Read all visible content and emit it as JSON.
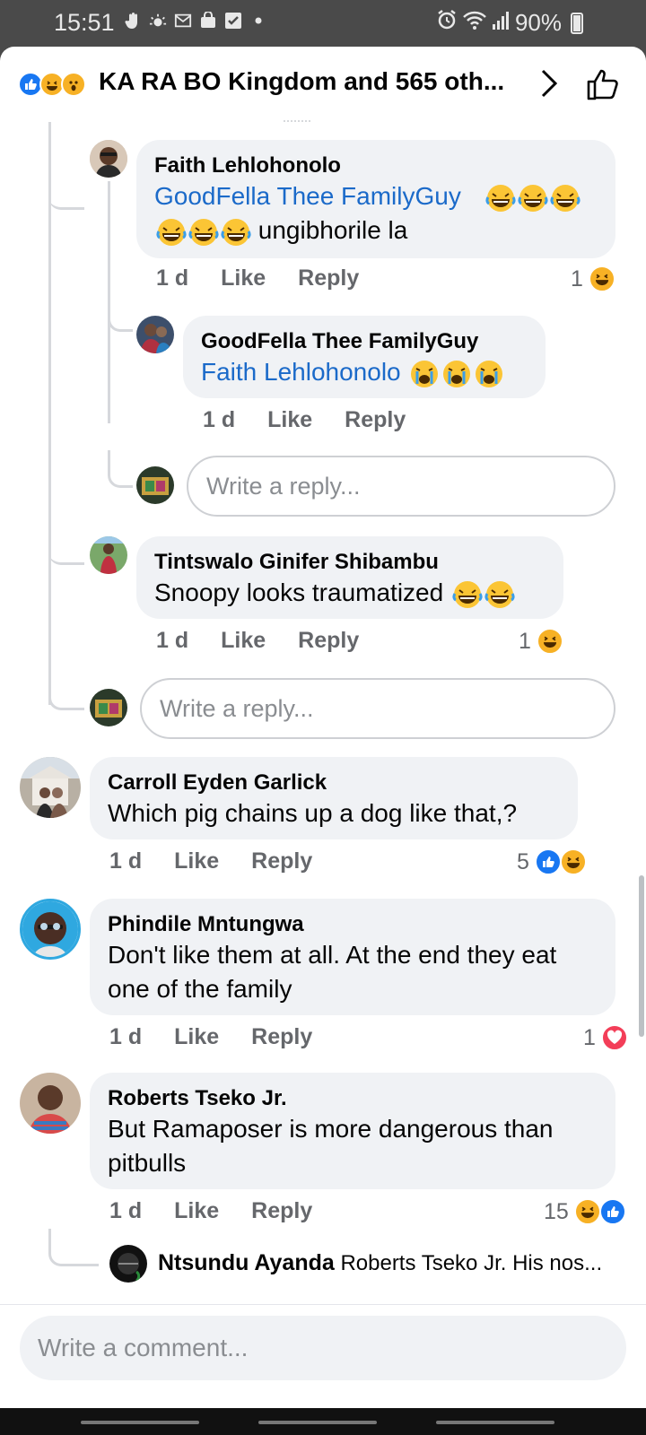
{
  "status_bar": {
    "time": "15:51",
    "battery": "90%",
    "left_icons": [
      "hand-icon",
      "weather-icon",
      "gmail-icon",
      "bag-icon",
      "check-icon",
      "dot-icon"
    ],
    "right_icons": [
      "alarm-icon",
      "wifi-icon",
      "signal-icon",
      "battery-icon"
    ]
  },
  "header": {
    "title": "KA RA BO Kingdom and 565 oth...",
    "reactions": [
      "like",
      "haha",
      "wow"
    ]
  },
  "comments": [
    {
      "name": "Faith Lehlohonolo",
      "mention": "GoodFella Thee FamilyGuy",
      "text": "ungibhorile la",
      "emojis": [
        "laugh-cry",
        "laugh-cry",
        "laugh-cry",
        "laugh-cry",
        "laugh-cry",
        "laugh-cry"
      ],
      "time": "1 d",
      "like": "Like",
      "reply": "Reply",
      "reaction_count": "1",
      "reactions": [
        "haha"
      ]
    },
    {
      "name": "GoodFella Thee FamilyGuy",
      "mention": "Faith Lehlohonolo",
      "text": "",
      "emojis": [
        "crying",
        "crying",
        "crying"
      ],
      "time": "1 d",
      "like": "Like",
      "reply": "Reply"
    },
    {
      "name": "Tintswalo Ginifer Shibambu",
      "text": "Snoopy looks traumatized",
      "emojis": [
        "laugh-cry",
        "laugh-cry"
      ],
      "time": "1 d",
      "like": "Like",
      "reply": "Reply",
      "reaction_count": "1",
      "reactions": [
        "haha"
      ]
    },
    {
      "name": "Carroll Eyden Garlick",
      "text": "Which pig  chains up a dog  like that,?",
      "time": "1 d",
      "like": "Like",
      "reply": "Reply",
      "reaction_count": "5",
      "reactions": [
        "like",
        "haha"
      ]
    },
    {
      "name": "Phindile Mntungwa",
      "text": "Don't like them at all. At the end they eat one of the family",
      "time": "1 d",
      "like": "Like",
      "reply": "Reply",
      "reaction_count": "1",
      "reactions": [
        "love"
      ]
    },
    {
      "name": "Roberts Tseko Jr.",
      "text": "But Ramaposer is more dangerous  than pitbulls",
      "time": "1 d",
      "like": "Like",
      "reply": "Reply",
      "reaction_count": "15",
      "reactions": [
        "haha",
        "like"
      ]
    }
  ],
  "reply_preview": {
    "name": "Ntsundu Ayanda",
    "text": "Roberts Tseko Jr. His nos..."
  },
  "inputs": {
    "reply_placeholder": "Write a reply...",
    "comment_placeholder": "Write a comment..."
  },
  "colors": {
    "mention": "#1b6ac9",
    "bubble": "#f0f2f5",
    "meta": "#65676b",
    "like_blue": "#1877f2",
    "haha_yellow": "#f7b125",
    "love_red": "#f33e58"
  }
}
